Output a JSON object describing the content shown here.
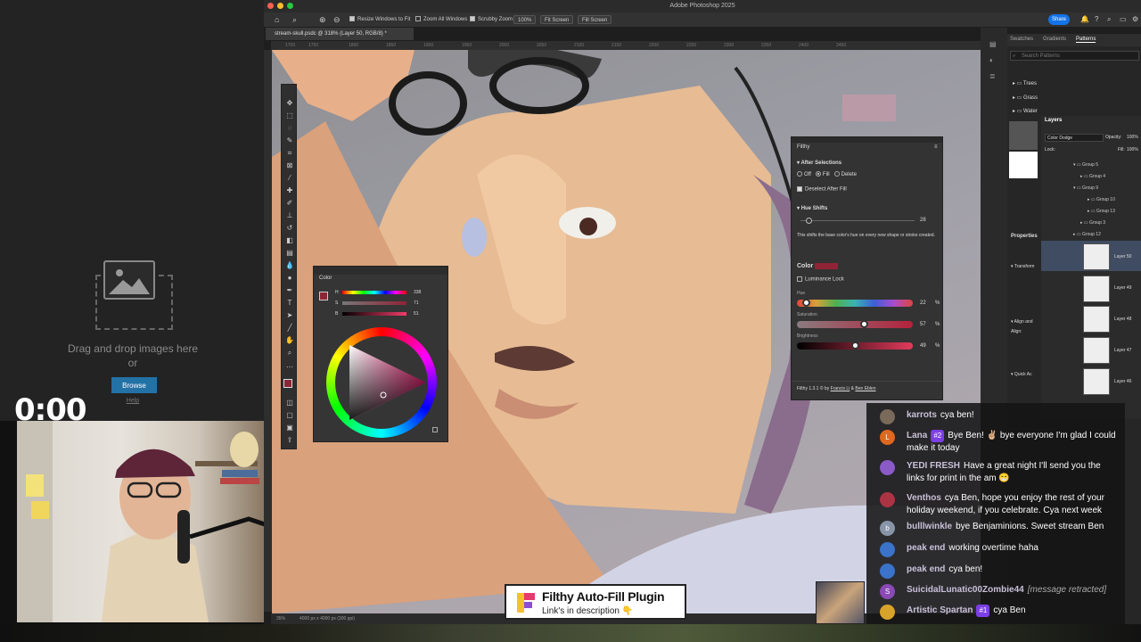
{
  "app": {
    "title": "Adobe Photoshop 2025"
  },
  "left_pane": {
    "drop_text": "Drag and drop images here",
    "or_text": "or",
    "browse_label": "Browse",
    "help_label": "Help"
  },
  "stream": {
    "timer": "0:00"
  },
  "options_bar": {
    "resize_windows": "Resize Windows to Fit",
    "zoom_all": "Zoom All Windows",
    "scrubby_zoom": "Scrubby Zoom",
    "zoom_percent": "100%",
    "fit_screen": "Fit Screen",
    "fill_screen": "Fill Screen",
    "share_label": "Share"
  },
  "document": {
    "tab_title": "stream-skull.psdc @ 318% (Layer 50, RGB/8) *",
    "status_zoom": "35%",
    "status_size": "4000 px x 4000 px (300 ppi)"
  },
  "rulers": {
    "h_ticks": [
      "1700",
      "1750",
      "1800",
      "1850",
      "1900",
      "1950",
      "2000",
      "2050",
      "2100",
      "2150",
      "2200",
      "2250",
      "2300",
      "2350",
      "2400",
      "2450"
    ]
  },
  "color_panel": {
    "title": "Color",
    "h_label": "H",
    "h_value": "338",
    "s_label": "S",
    "s_value": "71",
    "b_label": "B",
    "b_value": "51",
    "percent": "%"
  },
  "filthy": {
    "title": "Filthy",
    "after_selections": "After Selections",
    "off": "Off",
    "fill": "Fill",
    "delete": "Delete",
    "deselect_after_fill": "Deselect After Fill",
    "hue_shifts": "Hue Shifts",
    "hue_shift_value": "28",
    "hue_shift_desc": "This shifts the base color's hue on every new shape or stroke created.",
    "color_label": "Color",
    "luminance_lock": "Luminance Lock",
    "hue_label": "Hue",
    "hue_value": "22",
    "saturation_label": "Saturation",
    "saturation_value": "57",
    "brightness_label": "Brightness",
    "brightness_value": "49",
    "percent": "%",
    "footer_prefix": "Filthy 1.3.1 © by",
    "author1": "Francis Li",
    "amp": "&",
    "author2": "Ben Eblen",
    "accent_color": "#8f2436"
  },
  "panels": {
    "tabs": [
      "Swatches",
      "Gradients",
      "Patterns"
    ],
    "search_placeholder": "Search Patterns",
    "pattern_groups": [
      "Trees",
      "Grass",
      "Water"
    ],
    "layers_tab": "Layers",
    "blend_mode": "Color Dodge",
    "opacity_label": "Opacity:",
    "opacity_value": "100%",
    "lock_label": "Lock:",
    "fill_label": "Fill:",
    "fill_value": "100%",
    "properties_label": "Properties",
    "transform_label": "Transform",
    "align_label": "Align and",
    "align_sub": "Align:",
    "quick_label": "Quick Ac",
    "layers": [
      "Group 5",
      "Group 4",
      "Group 9",
      "Group 10",
      "Group 13",
      "Group 3",
      "Group 12"
    ],
    "thumb_layers": [
      "Layer 50",
      "Layer 49",
      "Layer 48",
      "Layer 47",
      "Layer 46"
    ]
  },
  "chat": [
    {
      "user": "karrots",
      "avatar_letter": "",
      "avatar_color": "#7a6a5a",
      "badge": "",
      "text": "cya ben!"
    },
    {
      "user": "Lana",
      "avatar_letter": "L",
      "avatar_color": "#e0671f",
      "badge": "#2",
      "text": "Bye Ben! ✌🏼 bye everyone I'm glad I could make it today"
    },
    {
      "user": "YEDI FRESH",
      "avatar_letter": "",
      "avatar_color": "#8a5ac7",
      "badge": "",
      "text": "Have a great night I'll send you the links for print in the am 😁"
    },
    {
      "user": "Venthos",
      "avatar_letter": "",
      "avatar_color": "#aa3344",
      "badge": "",
      "text": "cya Ben, hope you enjoy the rest of your holiday weekend, if you celebrate. Cya next week"
    },
    {
      "user": "bulllwinkle",
      "avatar_letter": "b",
      "avatar_color": "#8895a8",
      "badge": "",
      "text": "bye Benjaminions. Sweet stream Ben"
    },
    {
      "user": "peak end",
      "avatar_letter": "",
      "avatar_color": "#3a73c9",
      "badge": "",
      "text": "working overtime haha"
    },
    {
      "user": "peak end",
      "avatar_letter": "",
      "avatar_color": "#3a73c9",
      "badge": "",
      "text": "cya ben!"
    },
    {
      "user": "SuicidalLunatic00Zombie44",
      "avatar_letter": "S",
      "avatar_color": "#8a4ab5",
      "badge": "",
      "text": "[message retracted]"
    },
    {
      "user": "Artistic Spartan",
      "avatar_letter": "",
      "avatar_color": "#d8a32a",
      "badge": "#1",
      "text": "cya Ben"
    }
  ],
  "banner": {
    "title": "Filthy Auto-Fill Plugin",
    "subtitle": "Link's in description 👇"
  }
}
